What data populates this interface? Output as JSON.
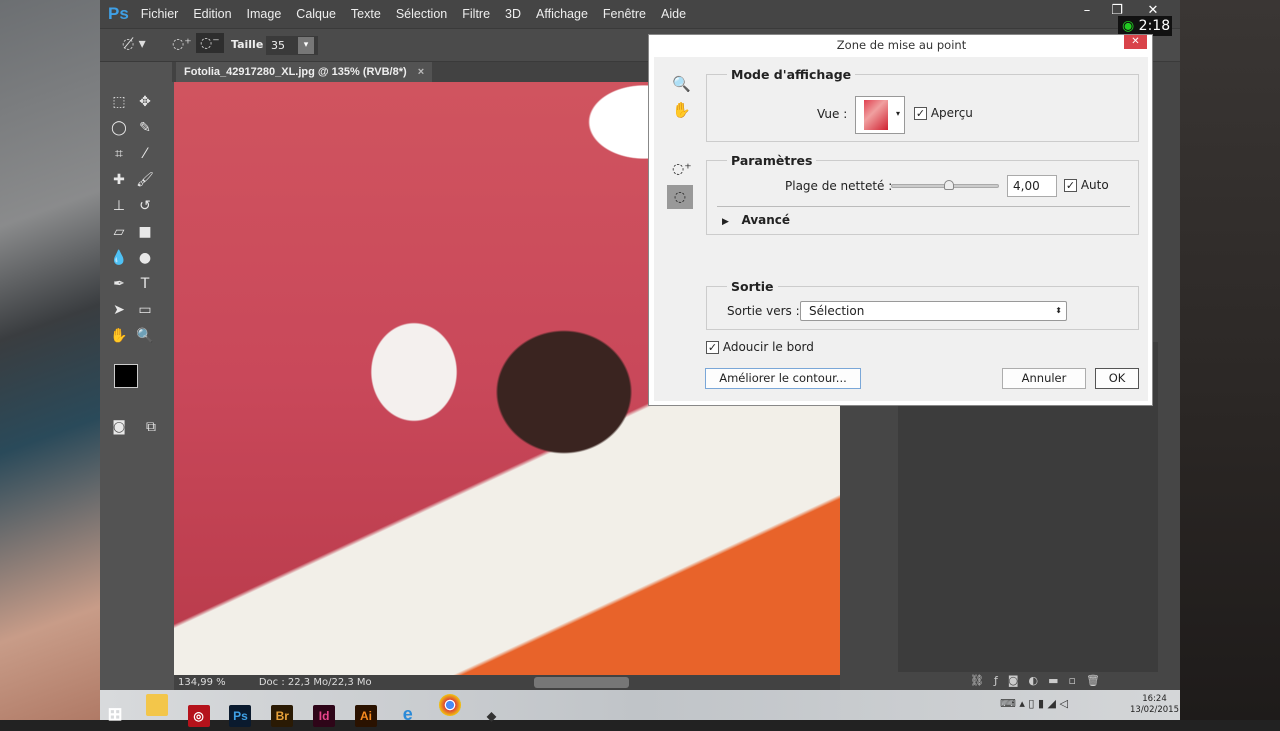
{
  "app": {
    "logo": "Ps",
    "menu": [
      "Fichier",
      "Edition",
      "Image",
      "Calque",
      "Texte",
      "Sélection",
      "Filtre",
      "3D",
      "Affichage",
      "Fenêtre",
      "Aide"
    ]
  },
  "window_controls": {
    "minimize": "–",
    "restore": "❐",
    "close": "✕"
  },
  "timer": "2:18",
  "options_bar": {
    "size_label": "Taille :",
    "size_value": "35"
  },
  "document": {
    "tab_title": "Fotolia_42917280_XL.jpg @ 135% (RVB/8*)",
    "tab_close": "×",
    "zoom": "134,99 %",
    "doc_info": "Doc : 22,3 Mo/22,3 Mo"
  },
  "dialog": {
    "title": "Zone de mise au point",
    "close": "✕",
    "display_mode": {
      "legend": "Mode d'affichage",
      "view_label": "Vue :",
      "preview_label": "Aperçu",
      "preview_checked": true
    },
    "params": {
      "legend": "Paramètres",
      "range_label": "Plage de netteté :",
      "range_value": "4,00",
      "slider_fraction": 0.53,
      "auto_label": "Auto",
      "auto_checked": true,
      "advanced_label": "Avancé"
    },
    "output": {
      "legend": "Sortie",
      "output_to_label": "Sortie vers :",
      "output_to_value": "Sélection"
    },
    "soften_label": "Adoucir le bord",
    "soften_checked": true,
    "refine_button": "Améliorer le contour...",
    "cancel_button": "Annuler",
    "ok_button": "OK"
  },
  "taskbar": {
    "apps": [
      "Ps",
      "Br",
      "Id",
      "Ai"
    ],
    "time": "16:24",
    "date": "13/02/2015"
  }
}
